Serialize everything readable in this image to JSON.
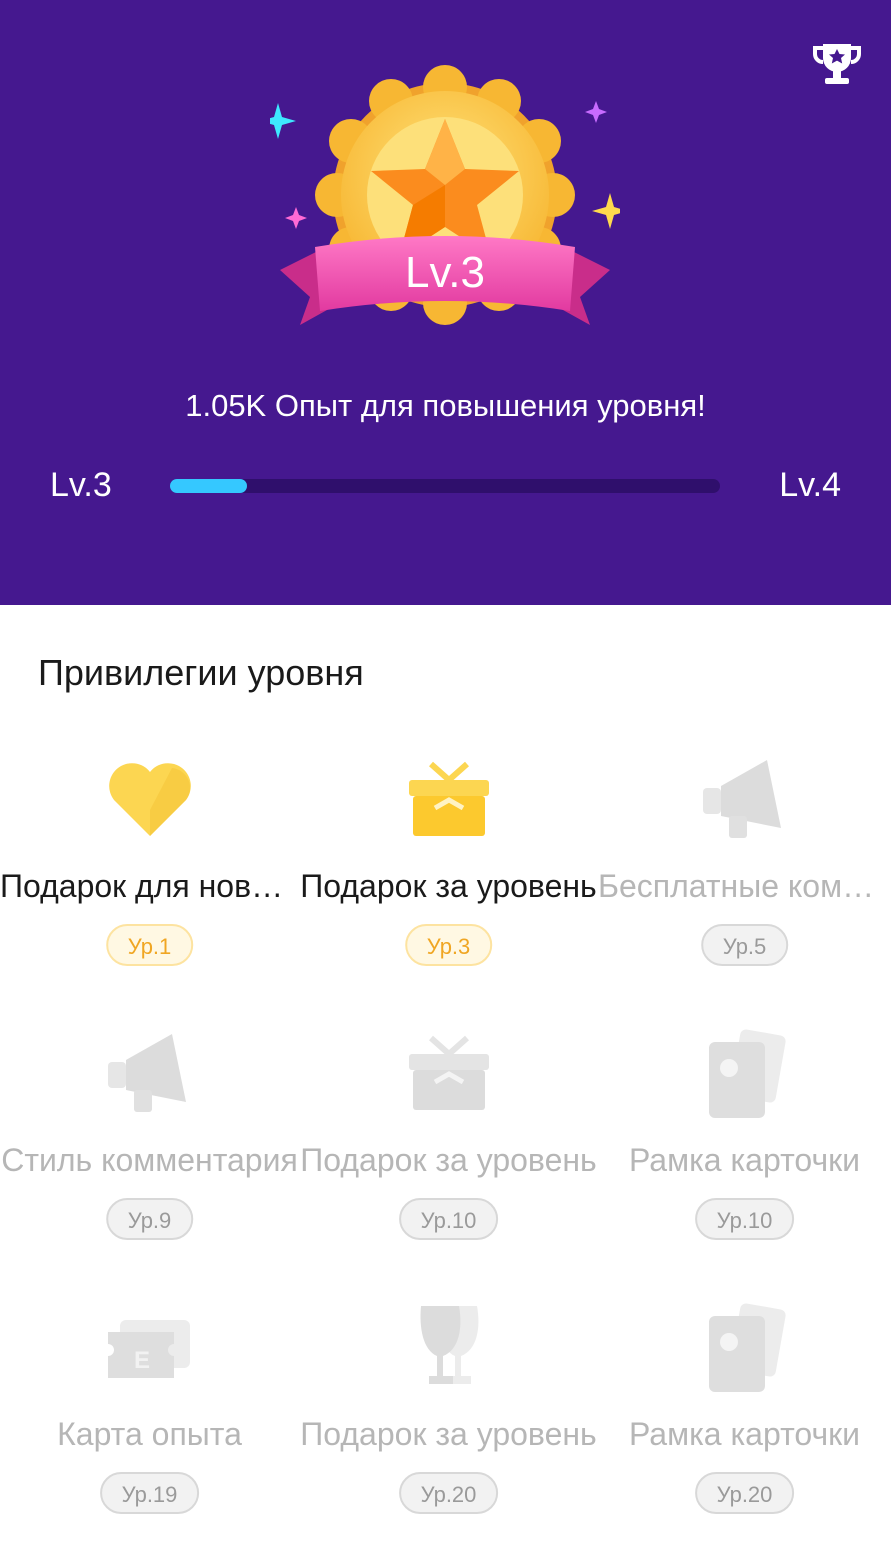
{
  "header": {
    "medal_level": "Lv.3",
    "xp_needed_text": "1.05K Опыт для повышения уровня!",
    "current_level": "Lv.3",
    "next_level": "Lv.4",
    "progress_fraction": 0.14,
    "trophy_icon": "trophy-icon"
  },
  "privileges": {
    "title": "Привилегии уровня",
    "items": [
      {
        "label": "Подарок для новичков",
        "level": "Ур.1",
        "icon": "heart-icon",
        "unlocked": true
      },
      {
        "label": "Подарок за уровень",
        "level": "Ур.3",
        "icon": "gift-icon",
        "unlocked": true
      },
      {
        "label": "Бесплатные комментарии",
        "level": "Ур.5",
        "icon": "megaphone-icon",
        "unlocked": false
      },
      {
        "label": "Стиль комментария",
        "level": "Ур.9",
        "icon": "megaphone-icon",
        "unlocked": false
      },
      {
        "label": "Подарок за уровень",
        "level": "Ур.10",
        "icon": "gift-icon",
        "unlocked": false
      },
      {
        "label": "Рамка карточки",
        "level": "Ур.10",
        "icon": "card-frame-icon",
        "unlocked": false
      },
      {
        "label": "Карта опыта",
        "level": "Ур.19",
        "icon": "exp-ticket-icon",
        "unlocked": false
      },
      {
        "label": "Подарок за уровень",
        "level": "Ур.20",
        "icon": "goblet-icon",
        "unlocked": false
      },
      {
        "label": "Рамка карточки",
        "level": "Ур.20",
        "icon": "card-frame-icon",
        "unlocked": false
      }
    ]
  },
  "colors": {
    "header_bg": "#45188f",
    "progress_fill": "#35c8ff",
    "unlocked_icon": "#fcd651",
    "locked_icon": "#e0e0e0",
    "unlocked_badge_text": "#f0a623"
  }
}
